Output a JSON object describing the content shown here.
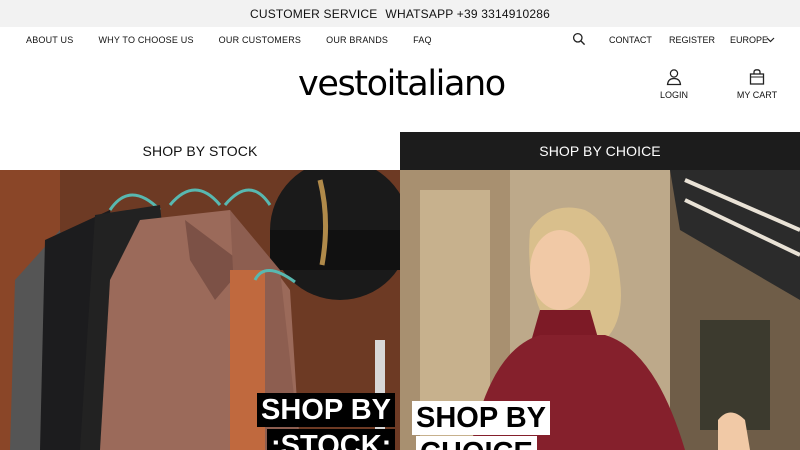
{
  "topbar": {
    "customer_service": "CUSTOMER SERVICE",
    "whatsapp": "WHATSAPP +39 3314910286"
  },
  "nav": {
    "left": [
      "ABOUT US",
      "WHY TO CHOOSE US",
      "OUR CUSTOMERS",
      "OUR BRANDS",
      "FAQ"
    ],
    "contact": "CONTACT",
    "register": "REGISTER",
    "region": "EUROPE"
  },
  "logo": {
    "text": "vestoitaliano"
  },
  "account": {
    "login": "LOGIN",
    "cart": "MY CART"
  },
  "tabs": {
    "stock": "SHOP BY STOCK",
    "choice": "SHOP BY CHOICE"
  },
  "panels": {
    "left_caption_line1": "SHOP BY",
    "left_caption_line2": ":STOCK:",
    "right_caption_line1": "SHOP BY",
    "right_caption_line2": "CHOICE"
  },
  "colors": {
    "tab_active_bg": "#1c1c1c",
    "topbar_bg": "#f2f2f2"
  }
}
